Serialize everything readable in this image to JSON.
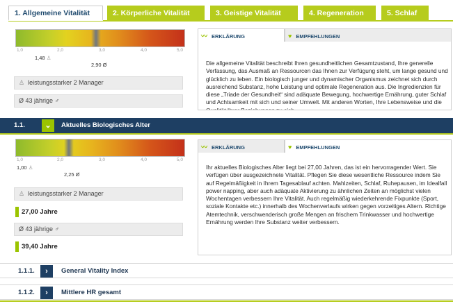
{
  "tabs": [
    {
      "label": "1. Allgemeine Vitalität",
      "active": true
    },
    {
      "label": "2. Körperliche Vitalität",
      "active": false
    },
    {
      "label": "3. Geistige Vitalität",
      "active": false
    },
    {
      "label": "4. Regeneration",
      "active": false
    },
    {
      "label": "5. Schlaf",
      "active": false
    }
  ],
  "colors": {
    "accent_green": "#b6cc1d",
    "value_green": "#9bc400",
    "header_navy": "#1e3f63",
    "title_blue": "#1f4a6e"
  },
  "scale_ticks": [
    "1,0",
    "2,0",
    "3,0",
    "4,0",
    "5,0"
  ],
  "section1": {
    "gauge": {
      "value": 2.9,
      "reference": 1.48
    },
    "marker_primary_label": "1,48",
    "marker_secondary_label": "2,90 Ø",
    "info_manager": "leistungsstarker 2 Manager",
    "info_age": "Ø 43 jährige ♂",
    "tab_explanation": "ERKLÄRUNG",
    "tab_recommendations": "EMPFEHLUNGEN",
    "text": "Die allgemeine Vitalität beschreibt Ihren gesundheitlichen Gesamtzustand, Ihre generelle Verfassung, das Ausmaß an Ressourcen das Ihnen zur Verfügung steht, um lange gesund und glücklich zu leben. Ein biologisch junger und dynamischer Organismus zeichnet sich durch ausreichend Substanz, hohe Leistung und optimale Regeneration aus. Die Ingredienzien für diese „Triade der Gesundheit“ sind adäquate Bewegung, hochwertige Ernährung, guter Schlaf und Achtsamkeit mit sich und seiner Umwelt. Mit anderen Worten, Ihre Lebensweise und die Qualität Ihrer Beziehungen zu sich"
  },
  "section1_1": {
    "number": "1.1.",
    "title": "Aktuelles Biologisches Alter",
    "gauge": {
      "value": 2.25,
      "reference": 1.0
    },
    "marker_primary_label": "1,00",
    "marker_secondary_label": "2,25 Ø",
    "info_manager": "leistungsstarker 2 Manager",
    "value_manager": "27,00 Jahre",
    "info_age": "Ø 43 jährige ♂",
    "value_age": "39,40 Jahre",
    "tab_explanation": "ERKLÄRUNG",
    "tab_recommendations": "EMPFEHLUNGEN",
    "text": "Ihr aktuelles Biologisches Alter liegt bei 27,00 Jahren, das ist ein hervorragender Wert. Sie verfügen über ausgezeichnete Vitalität. Pflegen Sie diese wesentliche Ressource indem Sie auf Regelmäßigkeit in Ihrem Tagesablauf achten. Mahlzeiten, Schlaf, Ruhepausen, im Idealfall power napping, aber auch adäquate Aktivierung zu ähnlichen Zeiten an möglichst vielen Wochentagen verbessern Ihre Vitalität. Auch regelmäßig wiederkehrende Fixpunkte (Sport, soziale Kontakte etc.) innerhalb des Wochenverlaufs wirken gegen vorzeitiges Altern. Richtige Atemtechnik, verschwenderisch große Mengen an frischem Trinkwasser und hochwertige Ernährung werden Ihre Substanz weiter verbessern."
  },
  "sub_sections": [
    {
      "number": "1.1.1.",
      "title": "General Vitality Index"
    },
    {
      "number": "1.1.2.",
      "title": "Mittlere HR gesamt"
    }
  ]
}
